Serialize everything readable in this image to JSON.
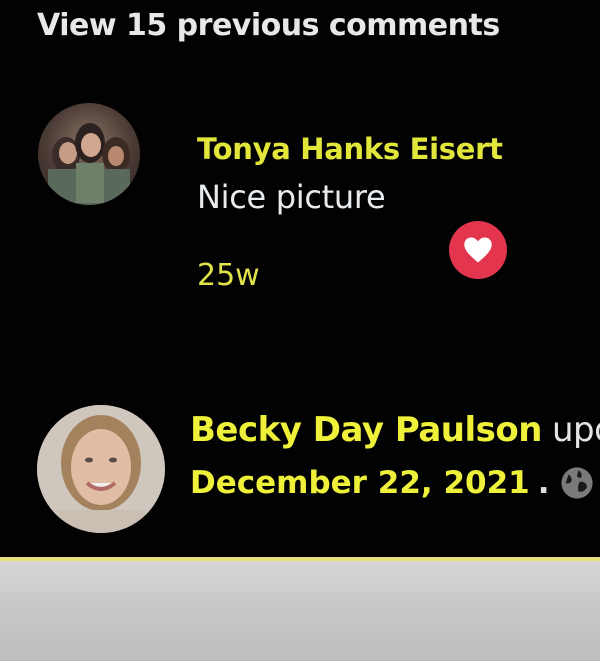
{
  "comments_section": {
    "view_previous_label": "View 15 previous comments"
  },
  "comment": {
    "author": "Tonya Hanks Eisert",
    "text": "Nice picture",
    "time": "25w",
    "reaction_icon": "heart-icon",
    "reaction_color": "#e4354f"
  },
  "post": {
    "author": "Becky Day Paulson",
    "action_text": "upd",
    "date": "December 22, 2021",
    "separator": ".",
    "privacy_icon": "globe-icon"
  },
  "colors": {
    "highlight_text": "#eef03a",
    "background": "#020202",
    "divider": "#e4e27c"
  }
}
